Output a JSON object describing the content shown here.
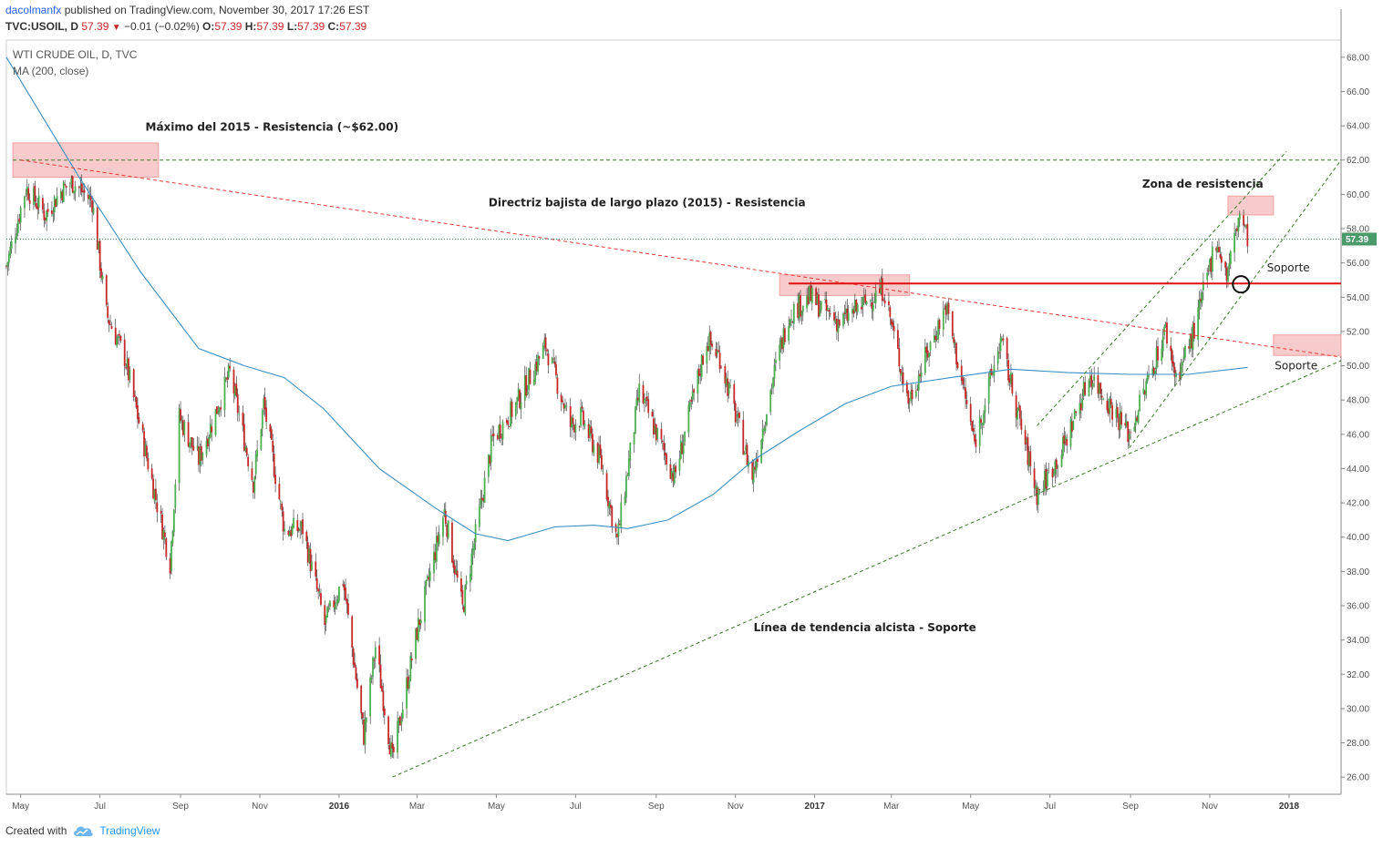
{
  "header": {
    "author": "dacolmanfx",
    "published": "published on TradingView.com, November 30, 2017 17:26 EST",
    "symbol": "TVC:USOIL, D",
    "last": "57.39",
    "change": "−0.01 (−0.02%)",
    "o_label": "O:",
    "o": "57.39",
    "h_label": "H:",
    "h": "57.39",
    "l_label": "L:",
    "l": "57.39",
    "c_label": "C:",
    "c": "57.39"
  },
  "indicator_label": "MA (200, close)",
  "footer": {
    "created_with": "Created with",
    "brand": "TradingView",
    "icon": "tradingview-cloud-icon"
  },
  "colors": {
    "up": "#4caf50",
    "down": "#c62828",
    "ma": "#3a8fc2",
    "green_dash": "#3d7a2a",
    "red_dash": "#e53935",
    "zone": "#f4b5b5"
  },
  "chart_data": {
    "type": "candlestick",
    "title": "WTI CRUDE OIL, D, TVC",
    "y_range": [
      25,
      69
    ],
    "y_ticks": [
      "26.00",
      "28.00",
      "30.00",
      "32.00",
      "34.00",
      "36.00",
      "38.00",
      "40.00",
      "42.00",
      "44.00",
      "46.00",
      "48.00",
      "50.00",
      "52.00",
      "54.00",
      "56.00",
      "58.00",
      "60.00",
      "62.00",
      "64.00",
      "66.00",
      "68.00"
    ],
    "x_range": [
      "2015-04-20",
      "2018-02-10"
    ],
    "x_ticks": [
      {
        "label": "May",
        "date": "2015-05-01"
      },
      {
        "label": "Jul",
        "date": "2015-07-01"
      },
      {
        "label": "Sep",
        "date": "2015-09-01"
      },
      {
        "label": "Nov",
        "date": "2015-11-01"
      },
      {
        "label": "2016",
        "date": "2016-01-01",
        "bold": true
      },
      {
        "label": "Mar",
        "date": "2016-03-01"
      },
      {
        "label": "May",
        "date": "2016-05-01"
      },
      {
        "label": "Jul",
        "date": "2016-07-01"
      },
      {
        "label": "Sep",
        "date": "2016-09-01"
      },
      {
        "label": "Nov",
        "date": "2016-11-01"
      },
      {
        "label": "2017",
        "date": "2017-01-01",
        "bold": true
      },
      {
        "label": "Mar",
        "date": "2017-03-01"
      },
      {
        "label": "May",
        "date": "2017-05-01"
      },
      {
        "label": "Jul",
        "date": "2017-07-01"
      },
      {
        "label": "Sep",
        "date": "2017-09-01"
      },
      {
        "label": "Nov",
        "date": "2017-11-01"
      },
      {
        "label": "2018",
        "date": "2018-01-01",
        "bold": true
      }
    ],
    "last_price": 57.39,
    "last_price_label": "57.39",
    "price_path": [
      [
        "2015-04-20",
        55.8
      ],
      [
        "2015-05-05",
        60.4
      ],
      [
        "2015-05-20",
        58.8
      ],
      [
        "2015-06-01",
        60.2
      ],
      [
        "2015-06-10",
        60.7
      ],
      [
        "2015-06-25",
        59.6
      ],
      [
        "2015-07-06",
        53.0
      ],
      [
        "2015-07-20",
        50.5
      ],
      [
        "2015-08-05",
        45.0
      ],
      [
        "2015-08-24",
        38.5
      ],
      [
        "2015-08-31",
        47.0
      ],
      [
        "2015-09-15",
        44.5
      ],
      [
        "2015-10-09",
        49.6
      ],
      [
        "2015-10-27",
        43.2
      ],
      [
        "2015-11-04",
        47.8
      ],
      [
        "2015-11-20",
        40.4
      ],
      [
        "2015-12-04",
        40.5
      ],
      [
        "2015-12-21",
        34.9
      ],
      [
        "2016-01-04",
        37.5
      ],
      [
        "2016-01-20",
        28.4
      ],
      [
        "2016-01-29",
        33.6
      ],
      [
        "2016-02-11",
        27.0
      ],
      [
        "2016-03-01",
        34.5
      ],
      [
        "2016-03-22",
        41.5
      ],
      [
        "2016-04-05",
        35.8
      ],
      [
        "2016-04-28",
        45.7
      ],
      [
        "2016-05-16",
        47.7
      ],
      [
        "2016-06-08",
        51.2
      ],
      [
        "2016-06-27",
        46.5
      ],
      [
        "2016-07-05",
        47.0
      ],
      [
        "2016-07-20",
        44.5
      ],
      [
        "2016-08-02",
        39.8
      ],
      [
        "2016-08-19",
        48.5
      ],
      [
        "2016-09-15",
        43.5
      ],
      [
        "2016-10-10",
        51.5
      ],
      [
        "2016-10-20",
        50.5
      ],
      [
        "2016-11-14",
        43.5
      ],
      [
        "2016-11-30",
        49.3
      ],
      [
        "2016-12-12",
        53.0
      ],
      [
        "2016-12-28",
        54.0
      ],
      [
        "2017-01-20",
        52.5
      ],
      [
        "2017-02-23",
        54.5
      ],
      [
        "2017-03-14",
        47.9
      ],
      [
        "2017-04-12",
        53.5
      ],
      [
        "2017-05-04",
        45.5
      ],
      [
        "2017-05-24",
        51.5
      ],
      [
        "2017-06-21",
        42.5
      ],
      [
        "2017-07-10",
        45.0
      ],
      [
        "2017-08-01",
        49.5
      ],
      [
        "2017-08-31",
        46.0
      ],
      [
        "2017-09-28",
        52.1
      ],
      [
        "2017-10-06",
        49.3
      ],
      [
        "2017-10-20",
        52.0
      ],
      [
        "2017-11-06",
        57.4
      ],
      [
        "2017-11-14",
        55.2
      ],
      [
        "2017-11-24",
        58.9
      ],
      [
        "2017-11-30",
        57.39
      ]
    ],
    "ma200_path": [
      [
        "2015-04-20",
        68.0
      ],
      [
        "2015-06-15",
        61.0
      ],
      [
        "2015-08-01",
        55.5
      ],
      [
        "2015-09-15",
        51.0
      ],
      [
        "2015-10-20",
        50.0
      ],
      [
        "2015-11-20",
        49.3
      ],
      [
        "2015-12-20",
        47.5
      ],
      [
        "2016-02-01",
        44.0
      ],
      [
        "2016-03-15",
        41.7
      ],
      [
        "2016-04-15",
        40.2
      ],
      [
        "2016-05-10",
        39.8
      ],
      [
        "2016-06-15",
        40.6
      ],
      [
        "2016-07-15",
        40.7
      ],
      [
        "2016-08-10",
        40.5
      ],
      [
        "2016-09-10",
        41.0
      ],
      [
        "2016-10-15",
        42.5
      ],
      [
        "2016-11-15",
        44.5
      ],
      [
        "2016-12-20",
        46.2
      ],
      [
        "2017-01-25",
        47.8
      ],
      [
        "2017-03-01",
        48.8
      ],
      [
        "2017-04-15",
        49.3
      ],
      [
        "2017-06-01",
        49.8
      ],
      [
        "2017-07-15",
        49.6
      ],
      [
        "2017-09-01",
        49.5
      ],
      [
        "2017-10-15",
        49.5
      ],
      [
        "2017-11-30",
        49.9
      ]
    ],
    "lines": [
      {
        "name": "resistance-2015-level",
        "style": "dash",
        "color": "green",
        "from": [
          "2015-04-25",
          62.0
        ],
        "to": [
          "2018-02-10",
          62.0
        ]
      },
      {
        "name": "long-term-downtrend",
        "style": "dash",
        "color": "red",
        "from": [
          "2015-05-01",
          62.0
        ],
        "to": [
          "2018-02-10",
          50.5
        ]
      },
      {
        "name": "long-term-uptrend",
        "style": "dash",
        "color": "green",
        "from": [
          "2016-02-11",
          26.0
        ],
        "to": [
          "2018-02-10",
          50.3
        ]
      },
      {
        "name": "channel-upper",
        "style": "dash",
        "color": "green",
        "from": [
          "2017-06-21",
          46.5
        ],
        "to": [
          "2017-12-30",
          62.5
        ]
      },
      {
        "name": "channel-lower",
        "style": "dash",
        "color": "green",
        "from": [
          "2017-08-31",
          45.2
        ],
        "to": [
          "2018-02-10",
          62.0
        ]
      },
      {
        "name": "support-level",
        "style": "solid",
        "color": "red",
        "from": [
          "2016-12-12",
          54.8
        ],
        "to": [
          "2018-02-10",
          54.8
        ]
      }
    ],
    "zones": [
      {
        "name": "zone-2015-high",
        "from": [
          "2015-04-25",
          63.0
        ],
        "to": [
          "2015-08-15",
          61.0
        ]
      },
      {
        "name": "zone-2017-top",
        "from": [
          "2016-12-05",
          55.3
        ],
        "to": [
          "2017-03-15",
          54.1
        ]
      },
      {
        "name": "zone-resistance",
        "from": [
          "2017-11-15",
          59.9
        ],
        "to": [
          "2017-12-20",
          58.8
        ]
      },
      {
        "name": "zone-support-right",
        "from": [
          "2017-12-20",
          51.8
        ],
        "to": [
          "2018-02-10",
          50.6
        ]
      }
    ],
    "circle_marker": [
      "2017-11-25",
      54.75
    ],
    "annotations": [
      {
        "name": "max-2015-label",
        "text": "Máximo del 2015 - Resistencia (~$62.00)",
        "at": [
          "2015-08-05",
          63.7
        ],
        "bold": true
      },
      {
        "name": "downtrend-label",
        "text": "Directriz bajista de largo plazo (2015) - Resistencia",
        "at": [
          "2016-04-25",
          59.3
        ],
        "bold": true
      },
      {
        "name": "resistance-zone-label",
        "text": "Zona de resistencia",
        "at": [
          "2017-09-10",
          60.4
        ],
        "bold": true
      },
      {
        "name": "support-label-top",
        "text": "Soporte",
        "at": [
          "2017-12-15",
          55.5
        ],
        "bold": false
      },
      {
        "name": "support-label-bottom",
        "text": "Soporte",
        "at": [
          "2017-12-21",
          49.8
        ],
        "bold": false
      },
      {
        "name": "uptrend-label",
        "text": "Línea de tendencia alcista - Soporte",
        "at": [
          "2016-11-15",
          34.5
        ],
        "bold": true
      }
    ]
  }
}
